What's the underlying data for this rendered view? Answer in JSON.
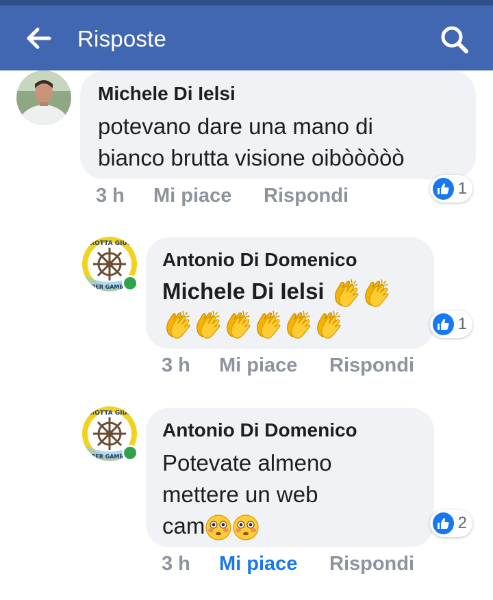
{
  "header": {
    "title": "Risposte",
    "back_icon": "arrow-left-icon",
    "search_icon": "search-icon",
    "background": "#4267b2"
  },
  "comments": [
    {
      "author": "Michele Di Ielsi",
      "text_lines": [
        "potevano dare una mano di",
        "bianco brutta visione oibòòòòò"
      ],
      "time": "3 h",
      "like_label": "Mi piace",
      "reply_label": "Rispondi",
      "reactions": "1",
      "avatar": "man-photo"
    },
    {
      "author": "Antonio Di Domenico",
      "mention": "Michele Di Ielsi",
      "emoji": "clapping-hands-emoji",
      "emoji_count": 8,
      "time": "3 h",
      "like_label": "Mi piace",
      "reply_label": "Rispondi",
      "reactions": "1",
      "avatar": "la-rotta-giusta-logo",
      "logo_text": [
        "LA ROTTA GIUSTA",
        "PER GAMBA"
      ]
    },
    {
      "author": "Antonio Di Domenico",
      "text_lines": [
        "Potevate almeno",
        "mettere un web",
        "cam"
      ],
      "emoji": "flushed-face-emoji",
      "emoji_count": 2,
      "time": "3 h",
      "like_label": "Mi piace",
      "like_active": true,
      "reply_label": "Rispondi",
      "reactions": "2",
      "avatar": "la-rotta-giusta-logo",
      "logo_text": [
        "LA ROTTA GIUSTA",
        "PER GAMBA"
      ]
    }
  ],
  "colors": {
    "bubble": "#f0f2f5",
    "meta_text": "#8d949e",
    "like_active": "#1877f2",
    "online": "#31a24c"
  }
}
